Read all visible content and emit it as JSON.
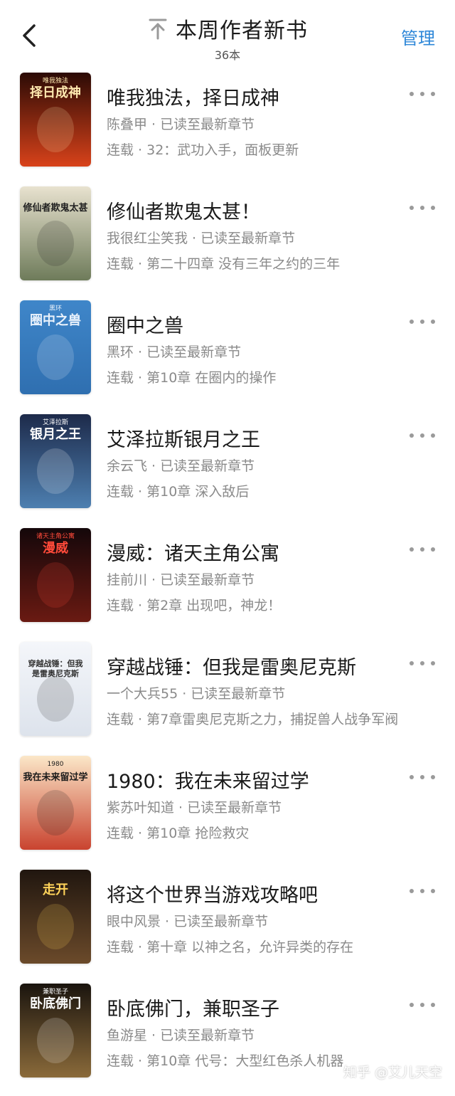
{
  "header": {
    "title": "本周作者新书",
    "count": "36本",
    "manage_label": "管理"
  },
  "books": [
    {
      "title": "唯我独法，择日成神",
      "meta": "陈叠甲 · 已读至最新章节",
      "latest": "连载 · 32：武功入手，面板更新",
      "cover_text": "择日成神",
      "cover_sub": "唯我独法",
      "cover_bg": [
        "#2b0a05",
        "#d8421a"
      ],
      "cover_fg": "#ffe9b0"
    },
    {
      "title": "修仙者欺鬼太甚！",
      "meta": "我很红尘笑我 · 已读至最新章节",
      "latest": "连载 · 第二十四章 没有三年之约的三年",
      "cover_text": "修仙者欺鬼太甚",
      "cover_sub": "",
      "cover_bg": [
        "#e8e2cf",
        "#6e7b5a"
      ],
      "cover_fg": "#222222"
    },
    {
      "title": "圈中之兽",
      "meta": "黑环 · 已读至最新章节",
      "latest": "连载 · 第10章 在圈内的操作",
      "cover_text": "圈中之兽",
      "cover_sub": "黑环",
      "cover_bg": [
        "#3f86c9",
        "#2f6fb0"
      ],
      "cover_fg": "#e8f1fb"
    },
    {
      "title": "艾泽拉斯银月之王",
      "meta": "余云飞 · 已读至最新章节",
      "latest": "连载 · 第10章 深入敌后",
      "cover_text": "银月之王",
      "cover_sub": "艾泽拉斯",
      "cover_bg": [
        "#1d2a4a",
        "#4d7fb0"
      ],
      "cover_fg": "#ffffff"
    },
    {
      "title": "漫威：诸天主角公寓",
      "meta": "挂前川 · 已读至最新章节",
      "latest": "连载 · 第2章 出现吧，神龙！",
      "cover_text": "漫威",
      "cover_sub": "诸天主角公寓",
      "cover_bg": [
        "#14070a",
        "#6a1a12"
      ],
      "cover_fg": "#ff4a3a"
    },
    {
      "title": "穿越战锤：但我是雷奥尼克斯",
      "meta": "一个大兵55 · 已读至最新章节",
      "latest": "连载 · 第7章雷奥尼克斯之力，捕捉兽人战争军阀",
      "cover_text": "穿越战锤：但我是雷奥尼克斯",
      "cover_sub": "",
      "cover_bg": [
        "#f4f6fa",
        "#dde3ec"
      ],
      "cover_fg": "#333333"
    },
    {
      "title": "1980：我在未来留过学",
      "meta": "紫苏叶知道 · 已读至最新章节",
      "latest": "连载 · 第10章 抢险救灾",
      "cover_text": "我在未来留过学",
      "cover_sub": "1980",
      "cover_bg": [
        "#fbe7c8",
        "#c9432f"
      ],
      "cover_fg": "#1a1a1a"
    },
    {
      "title": "将这个世界当游戏攻略吧",
      "meta": "眼中风景 · 已读至最新章节",
      "latest": "连载 · 第十章 以神之名，允许异类的存在",
      "cover_text": "走开",
      "cover_sub": "",
      "cover_bg": [
        "#20160f",
        "#6b4a2a"
      ],
      "cover_fg": "#ffd35a"
    },
    {
      "title": "卧底佛门，兼职圣子",
      "meta": "鱼游星 · 已读至最新章节",
      "latest": "连载 · 第10章 代号：大型红色杀人机器",
      "cover_text": "卧底佛门",
      "cover_sub": "兼职圣子",
      "cover_bg": [
        "#1a140e",
        "#8a6a3a"
      ],
      "cover_fg": "#ffffff"
    }
  ],
  "watermark": "知乎 @艾儿天空",
  "colors": {
    "accent": "#2e87d8",
    "meta_text": "#8a8a8a",
    "more_dots": "#9a9a9a"
  },
  "icons": {
    "back": "chevron-left-icon",
    "pin": "pin-top-icon",
    "more": "more-horizontal-icon"
  }
}
